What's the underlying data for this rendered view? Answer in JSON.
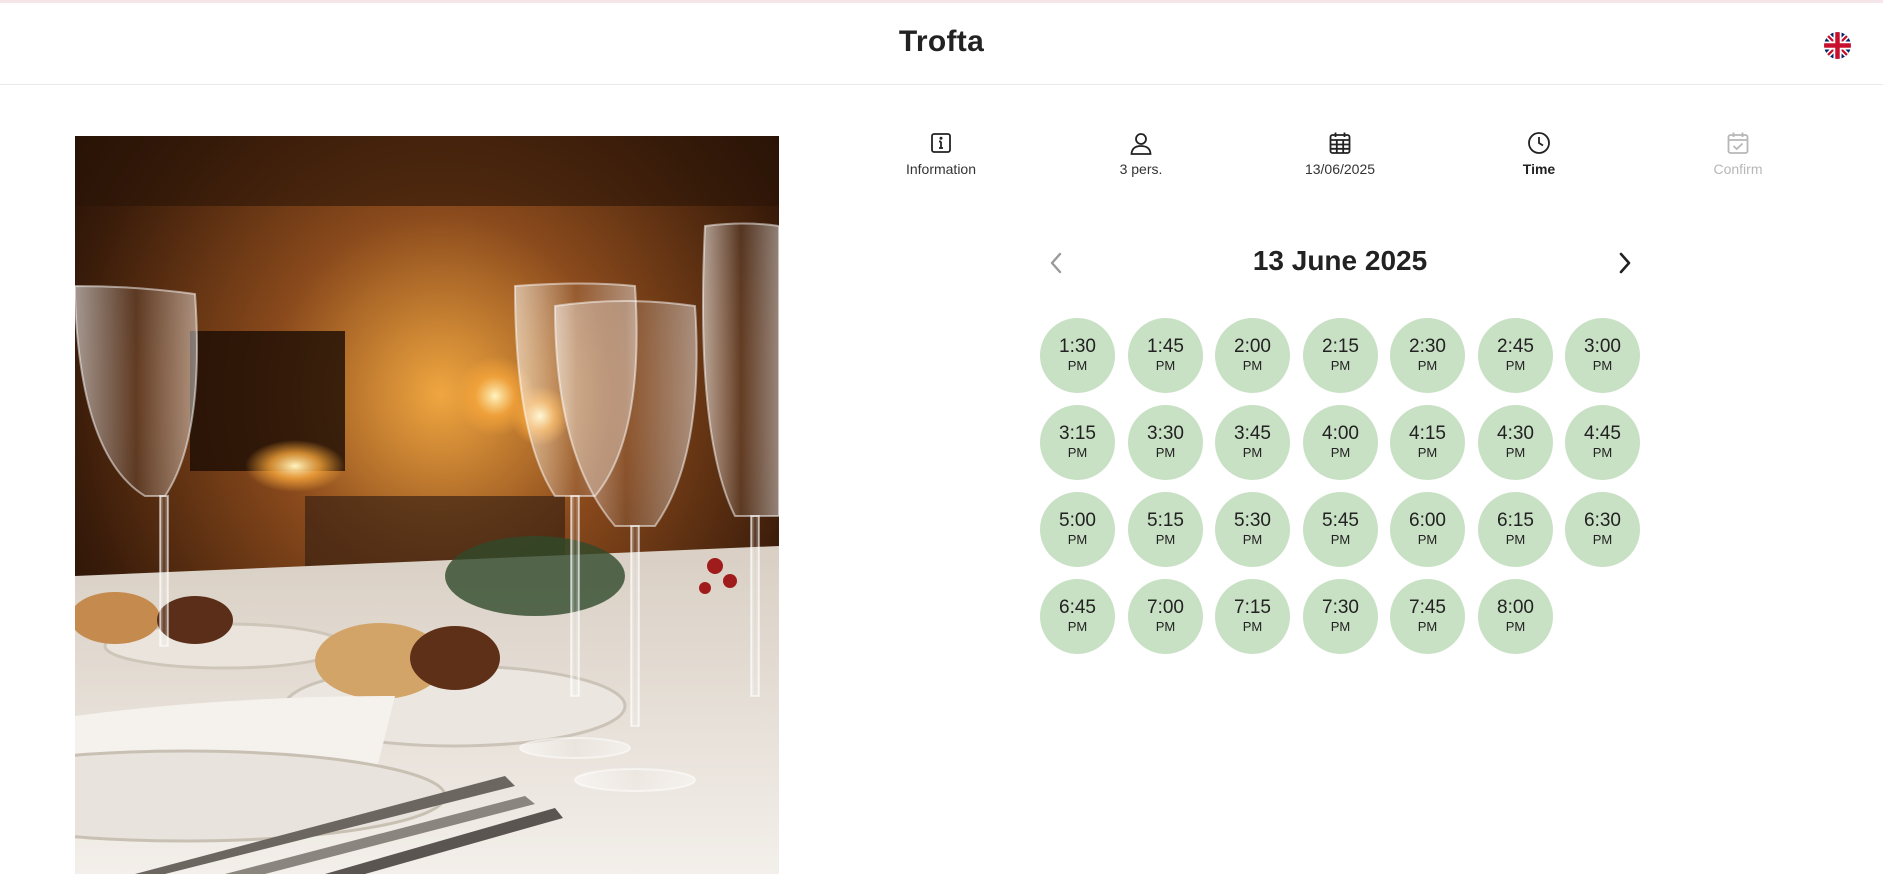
{
  "header": {
    "brand": "Trofta"
  },
  "steps": [
    {
      "label": "Information",
      "icon": "info-icon",
      "state": "done"
    },
    {
      "label": "3 pers.",
      "icon": "person-icon",
      "state": "done"
    },
    {
      "label": "13/06/2025",
      "icon": "calendar-icon",
      "state": "done"
    },
    {
      "label": "Time",
      "icon": "clock-icon",
      "state": "active"
    },
    {
      "label": "Confirm",
      "icon": "calendar-check-icon",
      "state": "disabled"
    }
  ],
  "date_picker": {
    "title": "13 June 2025"
  },
  "time_slots": [
    {
      "time": "1:30",
      "period": "PM"
    },
    {
      "time": "1:45",
      "period": "PM"
    },
    {
      "time": "2:00",
      "period": "PM"
    },
    {
      "time": "2:15",
      "period": "PM"
    },
    {
      "time": "2:30",
      "period": "PM"
    },
    {
      "time": "2:45",
      "period": "PM"
    },
    {
      "time": "3:00",
      "period": "PM"
    },
    {
      "time": "3:15",
      "period": "PM"
    },
    {
      "time": "3:30",
      "period": "PM"
    },
    {
      "time": "3:45",
      "period": "PM"
    },
    {
      "time": "4:00",
      "period": "PM"
    },
    {
      "time": "4:15",
      "period": "PM"
    },
    {
      "time": "4:30",
      "period": "PM"
    },
    {
      "time": "4:45",
      "period": "PM"
    },
    {
      "time": "5:00",
      "period": "PM"
    },
    {
      "time": "5:15",
      "period": "PM"
    },
    {
      "time": "5:30",
      "period": "PM"
    },
    {
      "time": "5:45",
      "period": "PM"
    },
    {
      "time": "6:00",
      "period": "PM"
    },
    {
      "time": "6:15",
      "period": "PM"
    },
    {
      "time": "6:30",
      "period": "PM"
    },
    {
      "time": "6:45",
      "period": "PM"
    },
    {
      "time": "7:00",
      "period": "PM"
    },
    {
      "time": "7:15",
      "period": "PM"
    },
    {
      "time": "7:30",
      "period": "PM"
    },
    {
      "time": "7:45",
      "period": "PM"
    },
    {
      "time": "8:00",
      "period": "PM"
    }
  ],
  "colors": {
    "slot_bg": "#c8e1c4",
    "text": "#222222",
    "disabled": "#b7b7b7"
  }
}
